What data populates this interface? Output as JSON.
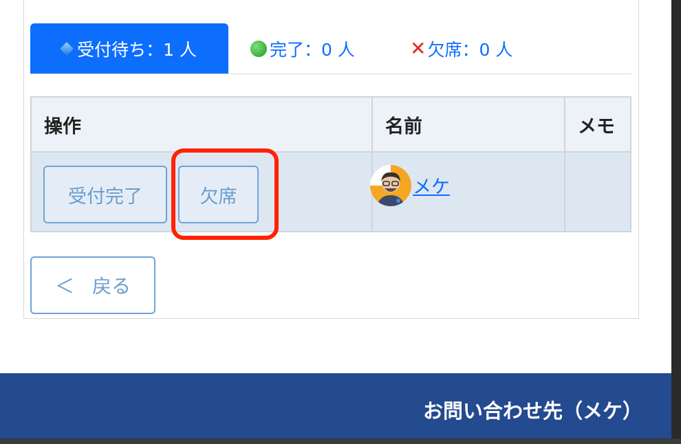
{
  "tabs": [
    {
      "label": "受付待ち：1 人",
      "icon": "diamond-icon",
      "active": true
    },
    {
      "label": "完了：0 人",
      "icon": "green-circle-icon",
      "active": false
    },
    {
      "label": "欠席：0 人",
      "icon": "red-x-icon",
      "active": false
    }
  ],
  "table": {
    "headers": [
      "操作",
      "名前",
      "メモ"
    ],
    "rows": [
      {
        "actions": {
          "done_label": "受付完了",
          "absent_label": "欠席"
        },
        "name": "メケ",
        "memo": ""
      }
    ]
  },
  "back_button": {
    "arrow": "＜",
    "label": "戻る"
  },
  "footer": {
    "contact": "お問い合わせ先（メケ）"
  },
  "colors": {
    "primary": "#0d6efd",
    "footer_bg": "#244a8f",
    "highlight": "#ff2200",
    "row_bg": "#dde7f2"
  }
}
